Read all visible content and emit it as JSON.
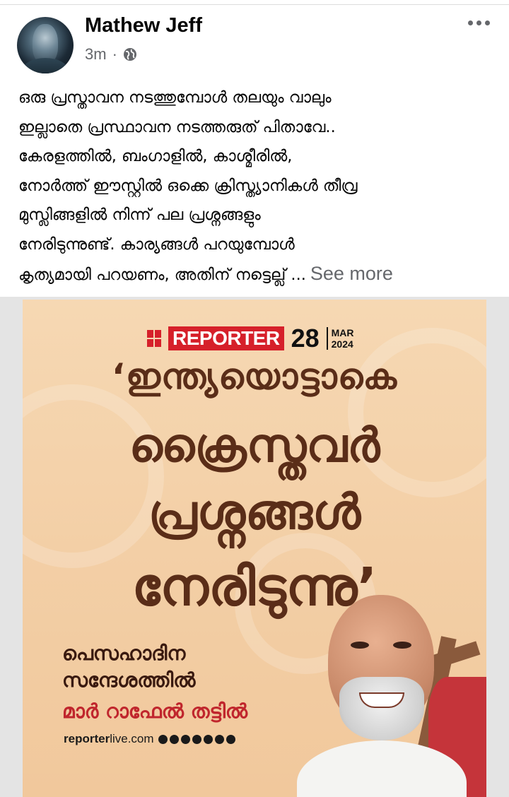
{
  "post": {
    "author": "Mathew Jeff",
    "time": "3m",
    "separator": "·",
    "text_lines": [
      "ഒരു പ്രസ്താവന നടത്തുമ്പോൾ തലയും വാലും",
      "ഇല്ലാതെ പ്രസ്ഥാവന നടത്തരുത് പിതാവേ..",
      "കേരളത്തിൽ, ബംഗാളിൽ, കാശ്മീരിൽ,",
      "നോർത്ത് ഈസ്റ്റിൽ ഒക്കെ ക്രിസ്ത്യാനികൾ തീവ്ര",
      "മുസ്ലിങ്ങളിൽ നിന്ന് പല പ്രശ്നങ്ങളും",
      "നേരിടുന്നുണ്ട്. കാര്യങ്ങൾ പറയുമ്പോൾ",
      "കൃത്യമായി പറയണം, അതിന് നട്ടെല്ല് ..."
    ],
    "see_more": "See more",
    "icons": {
      "audience": "globe-icon",
      "menu": "more-options-icon"
    }
  },
  "image": {
    "brand": "REPORTER",
    "day": "28",
    "month": "MAR",
    "year": "2024",
    "headline": [
      "‘ഇന്ത്യയൊട്ടാകെ",
      "ക്രൈസ്തവർ",
      "പ്രശ്നങ്ങൾ",
      "നേരിടുന്നു’"
    ],
    "sub": [
      "പെസഹാദിന",
      "സന്ദേശത്തിൽ",
      "മാർ റാഫേൽ തട്ടിൽ"
    ],
    "site_bold": "reporter",
    "site_rest": "live.com",
    "colors": {
      "brand_red": "#d6202a",
      "headline_brown": "#5a2d18",
      "background": "#f3cfa6"
    }
  }
}
